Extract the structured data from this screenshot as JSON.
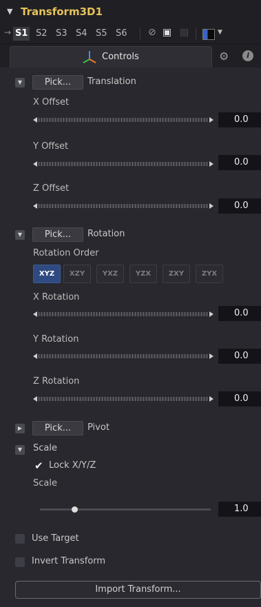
{
  "header": {
    "title": "Transform3D1"
  },
  "slots": [
    "S1",
    "S2",
    "S3",
    "S4",
    "S5",
    "S6"
  ],
  "tabs": {
    "controls_label": "Controls"
  },
  "translation": {
    "pick_label": "Pick...",
    "section_label": "Translation",
    "x_label": "X Offset",
    "x_value": "0.0",
    "y_label": "Y Offset",
    "y_value": "0.0",
    "z_label": "Z Offset",
    "z_value": "0.0"
  },
  "rotation": {
    "pick_label": "Pick...",
    "section_label": "Rotation",
    "order_label": "Rotation Order",
    "orders": [
      "XYZ",
      "XZY",
      "YXZ",
      "YZX",
      "ZXY",
      "ZYX"
    ],
    "selected_order": "XYZ",
    "x_label": "X Rotation",
    "x_value": "0.0",
    "y_label": "Y Rotation",
    "y_value": "0.0",
    "z_label": "Z Rotation",
    "z_value": "0.0"
  },
  "pivot": {
    "pick_label": "Pick...",
    "section_label": "Pivot"
  },
  "scale": {
    "section_label": "Scale",
    "lock_label": "Lock X/Y/Z",
    "lock_checked": true,
    "field_label": "Scale",
    "value": "1.0"
  },
  "options": {
    "use_target_label": "Use Target",
    "use_target_checked": false,
    "invert_label": "Invert Transform",
    "invert_checked": false
  },
  "import_button_label": "Import Transform...",
  "colors": {
    "title": "#e6c35a",
    "accent": "#2f4a80",
    "background": "#28282e"
  },
  "icons": [
    "collapse-chevron",
    "pin",
    "disable",
    "lock",
    "controls-axis",
    "gear",
    "info",
    "checkmark"
  ]
}
